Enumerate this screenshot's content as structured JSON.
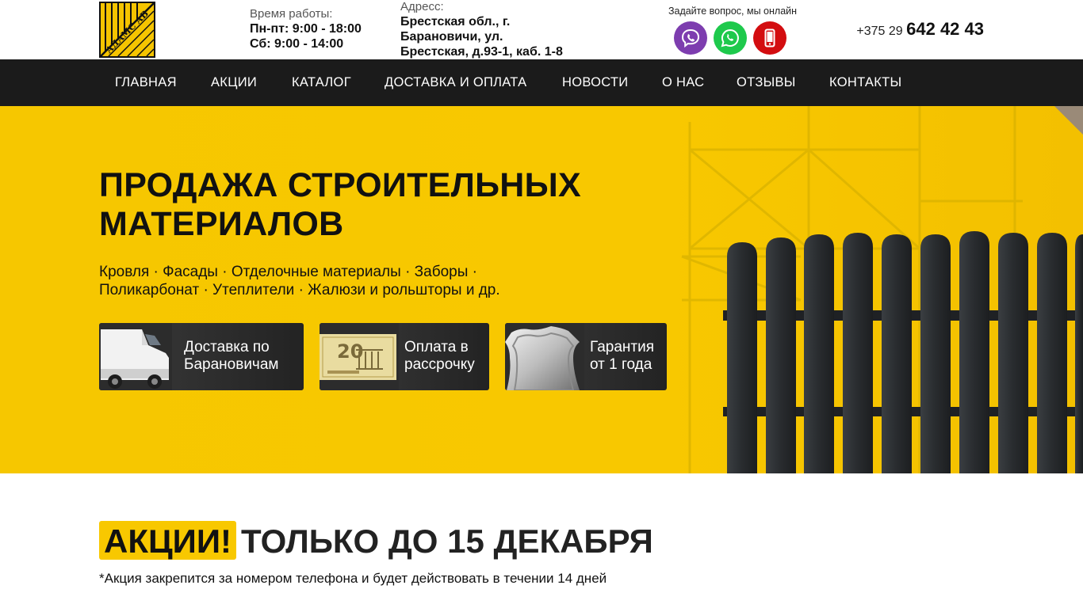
{
  "header": {
    "logo_text": "АДАМС АВ",
    "hours_label": "Время работы:",
    "hours_weekdays": "Пн-пт: 9:00 - 18:00",
    "hours_saturday": "Сб: 9:00 - 14:00",
    "address_label": "Адресс:",
    "address_line1": "Брестская обл., г.",
    "address_line2": "Барановичи, ул.",
    "address_line3": "Брестская, д.93-1, каб. 1-8",
    "online_label": "Задайте вопрос, мы онлайн",
    "messengers": [
      "viber-icon",
      "whatsapp-icon",
      "mobile-phone-icon"
    ],
    "phone_prefix": "+375 29",
    "phone_number": "642 42 43"
  },
  "nav": {
    "items": [
      "ГЛАВНАЯ",
      "АКЦИИ",
      "КАТАЛОГ",
      "ДОСТАВКА И ОПЛАТА",
      "НОВОСТИ",
      "О НАС",
      "ОТЗЫВЫ",
      "КОНТАКТЫ"
    ]
  },
  "hero": {
    "title_line1": "ПРОДАЖА СТРОИТЕЛЬНЫХ",
    "title_line2": "МАТЕРИАЛОВ",
    "subtitle_line1": "Кровля · Фасады · Отделочные материалы · Заборы ·",
    "subtitle_line2": "Поликарбонат · Утеплители · Жалюзи и рольшторы и др.",
    "features": [
      {
        "line1": "Доставка по",
        "line2": "Барановичам",
        "icon": "delivery-van-image"
      },
      {
        "line1": "Оплата в",
        "line2": "рассрочку",
        "icon": "banknote-image"
      },
      {
        "line1": "Гарантия",
        "line2": "от 1 года",
        "icon": "shield-image"
      }
    ]
  },
  "promo": {
    "highlight": "АКЦИИ!",
    "title_rest": "ТОЛЬКО ДО 15 ДЕКАБРЯ",
    "note": "*Акция закрепится за номером телефона и будет действовать в течении 14 дней"
  },
  "colors": {
    "accent_yellow": "#f8c800",
    "nav_bg": "#1b1b1b",
    "viber": "#7d3daf",
    "whatsapp": "#1ec94c",
    "phone": "#d30d10"
  }
}
